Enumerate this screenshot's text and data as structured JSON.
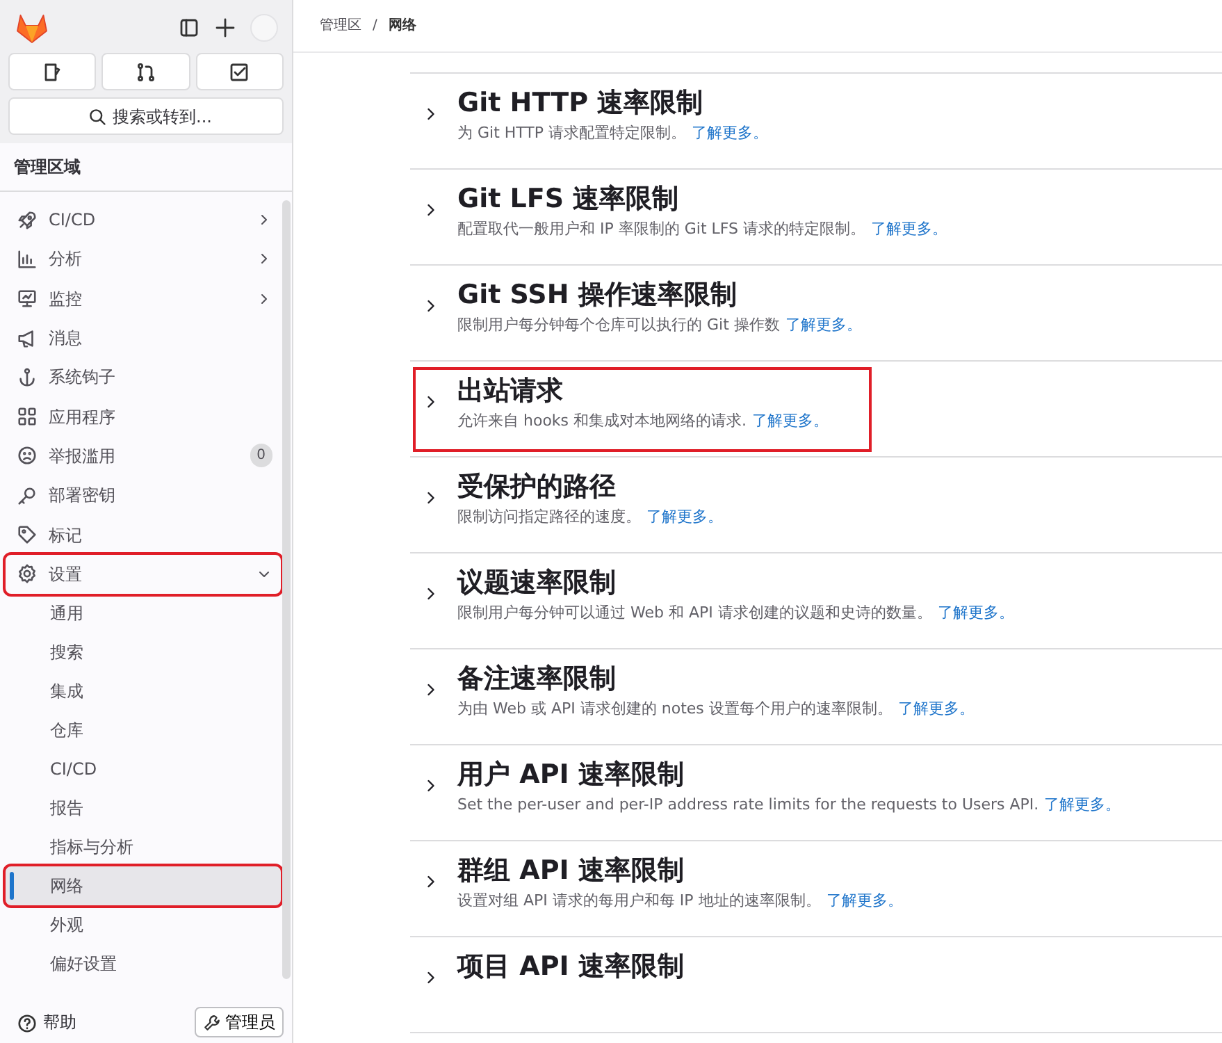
{
  "sidebar": {
    "search": {
      "placeholder": "搜索或转到..."
    },
    "title": "管理区域",
    "items": [
      {
        "label": "CI/CD",
        "kind": "group",
        "expanded": false,
        "highlighted": false
      },
      {
        "label": "分析",
        "kind": "group",
        "expanded": false,
        "highlighted": false
      },
      {
        "label": "监控",
        "kind": "group",
        "expanded": false,
        "highlighted": false
      },
      {
        "label": "消息",
        "kind": "link",
        "highlighted": false
      },
      {
        "label": "系统钩子",
        "kind": "link",
        "highlighted": false
      },
      {
        "label": "应用程序",
        "kind": "link",
        "highlighted": false
      },
      {
        "label": "举报滥用",
        "kind": "link",
        "badge": "0",
        "highlighted": false
      },
      {
        "label": "部署密钥",
        "kind": "link",
        "highlighted": false
      },
      {
        "label": "标记",
        "kind": "link",
        "highlighted": false
      },
      {
        "label": "设置",
        "kind": "group",
        "expanded": true,
        "highlighted": true,
        "children": [
          {
            "label": "通用",
            "selected": false,
            "highlighted": false
          },
          {
            "label": "搜索",
            "selected": false,
            "highlighted": false
          },
          {
            "label": "集成",
            "selected": false,
            "highlighted": false
          },
          {
            "label": "仓库",
            "selected": false,
            "highlighted": false
          },
          {
            "label": "CI/CD",
            "selected": false,
            "highlighted": false
          },
          {
            "label": "报告",
            "selected": false,
            "highlighted": false
          },
          {
            "label": "指标与分析",
            "selected": false,
            "highlighted": false
          },
          {
            "label": "网络",
            "selected": true,
            "highlighted": true
          },
          {
            "label": "外观",
            "selected": false,
            "highlighted": false
          },
          {
            "label": "偏好设置",
            "selected": false,
            "highlighted": false
          }
        ]
      }
    ],
    "footer": {
      "help": "帮助",
      "admin": "管理员"
    }
  },
  "breadcrumb": {
    "items": [
      "管理区",
      "网络"
    ],
    "separator": "/"
  },
  "sections": [
    {
      "title": "Git HTTP 速率限制",
      "description": "为 Git HTTP 请求配置特定限制。",
      "link": "了解更多。",
      "highlighted": false
    },
    {
      "title": "Git LFS 速率限制",
      "description": "配置取代一般用户和 IP 率限制的 Git LFS 请求的特定限制。",
      "link": "了解更多。",
      "highlighted": false
    },
    {
      "title": "Git SSH 操作速率限制",
      "description": "限制用户每分钟每个仓库可以执行的 Git 操作数",
      "link": "了解更多。",
      "highlighted": false
    },
    {
      "title": "出站请求",
      "description": "允许来自 hooks 和集成对本地网络的请求.",
      "link": "了解更多。",
      "highlighted": true
    },
    {
      "title": "受保护的路径",
      "description": "限制访问指定路径的速度。",
      "link": "了解更多。",
      "highlighted": false
    },
    {
      "title": "议题速率限制",
      "description": "限制用户每分钟可以通过 Web 和 API 请求创建的议题和史诗的数量。",
      "link": "了解更多。",
      "highlighted": false
    },
    {
      "title": "备注速率限制",
      "description": "为由 Web 或 API 请求创建的 notes 设置每个用户的速率限制。",
      "link": "了解更多。",
      "highlighted": false
    },
    {
      "title": "用户 API 速率限制",
      "description": "Set the per-user and per-IP address rate limits for the requests to Users API.",
      "link": "了解更多。",
      "highlighted": false
    },
    {
      "title": "群组 API 速率限制",
      "description": "设置对组 API 请求的每用户和每 IP 地址的速率限制。",
      "link": "了解更多。",
      "highlighted": false
    },
    {
      "title": "项目 API 速率限制",
      "highlighted": false
    }
  ]
}
